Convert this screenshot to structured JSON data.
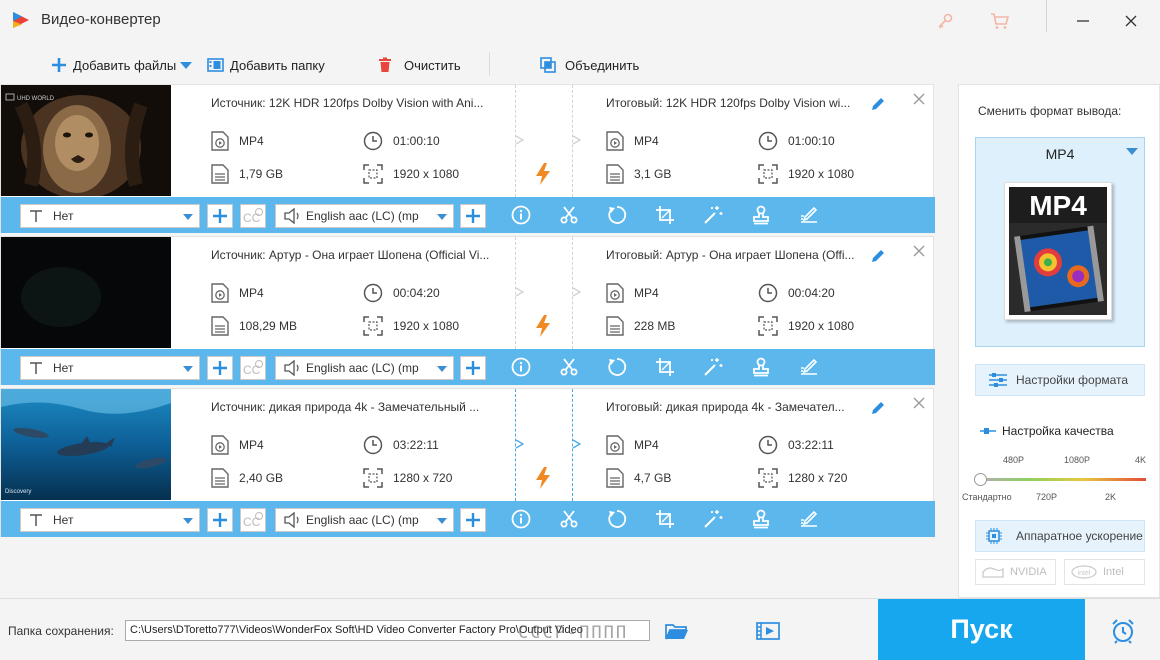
{
  "window": {
    "title": "Видео-конвертер",
    "icons": [
      "app-logo-icon",
      "key-icon",
      "cart-icon",
      "minimize-icon",
      "close-icon"
    ]
  },
  "toolbar": {
    "add_files": "Добавить файлы",
    "add_folder": "Добавить папку",
    "clear": "Очистить",
    "merge": "Объединить"
  },
  "files": [
    {
      "source": "Источник: 12K HDR 120fps Dolby Vision with Ani...",
      "output": "Итоговый: 12K HDR 120fps Dolby Vision wi...",
      "thumb_label": "UHD WORLD",
      "src_format": "MP4",
      "src_duration": "01:00:10",
      "src_size": "1,79 GB",
      "src_resolution": "1920 x 1080",
      "out_format": "MP4",
      "out_duration": "01:00:10",
      "out_size": "3,1 GB",
      "out_resolution": "1920 x 1080",
      "subtitle": "Нет",
      "audio": "English aac (LC) (mp"
    },
    {
      "source": "Источник: Артур - Она играет Шопена (Official Vi...",
      "output": "Итоговый: Артур - Она играет Шопена (Offi...",
      "thumb_label": "",
      "src_format": "MP4",
      "src_duration": "00:04:20",
      "src_size": "108,29 MB",
      "src_resolution": "1920 x 1080",
      "out_format": "MP4",
      "out_duration": "00:04:20",
      "out_size": "228 MB",
      "out_resolution": "1920 x 1080",
      "subtitle": "Нет",
      "audio": "English aac (LC) (mp"
    },
    {
      "source": "Источник: дикая природа 4k - Замечательный ...",
      "output": "Итоговый: дикая природа 4k - Замечател...",
      "thumb_label": "Discovery",
      "src_format": "MP4",
      "src_duration": "03:22:11",
      "src_size": "2,40 GB",
      "src_resolution": "1280 x 720",
      "out_format": "MP4",
      "out_duration": "03:22:11",
      "out_size": "4,7 GB",
      "out_resolution": "1280 x 720",
      "subtitle": "Нет",
      "audio": "English aac (LC) (mp"
    }
  ],
  "bar_icons": [
    "info-icon",
    "scissors-icon",
    "rotate-icon",
    "crop-icon",
    "effects-wand-icon",
    "watermark-stamp-icon",
    "edit-subtitle-icon"
  ],
  "right_panel": {
    "format_label": "Сменить формат вывода:",
    "format_name": "MP4",
    "format_image_text": "MP4",
    "format_settings": "Настройки формата",
    "quality_title": "Настройка качества",
    "quality_top_labels": [
      "480P",
      "1080P",
      "4K"
    ],
    "quality_bottom_labels": [
      "Стандартно",
      "720P",
      "2K"
    ],
    "quality_level": 0,
    "hw_accel": "Аппаратное ускорение",
    "vendors": [
      "NVIDIA",
      "Intel"
    ]
  },
  "footer": {
    "save_label": "Папка сохранения:",
    "save_path": "C:\\Users\\DToretto777\\Videos\\WonderFox Soft\\HD Video Converter Factory Pro\\Output Video",
    "start": "Пуск",
    "watermark": "CCCP-ПППП"
  },
  "colors": {
    "accent": "#16a7ee",
    "bar": "#5bb7ec",
    "bolt": "#f08a24",
    "delete": "#e8453c"
  }
}
